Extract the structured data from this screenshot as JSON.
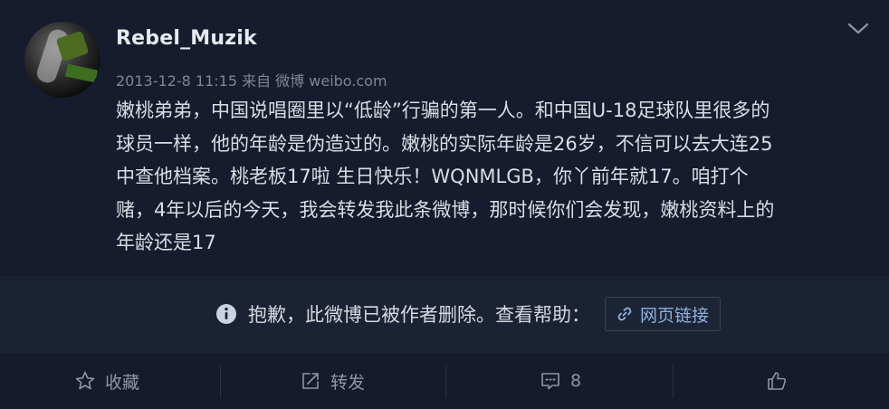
{
  "post": {
    "username": "Rebel_Muzik",
    "meta": "2013-12-8 11:15 来自 微博 weibo.com",
    "lines": [
      "嫩桃弟弟，中国说唱圈里以“低龄”行骗的第一人。和中国U-18足球队里很多的",
      "球员一样，他的年龄是伪造过的。嫩桃的实际年龄是26岁，不信可以去大连25",
      "中查他档案。桃老板17啦 生日快乐！WQNMLGB，你丫前年就17。咱打个",
      "赌，4年以后的今天，我会转发我此条微博，那时候你们会发现，嫩桃资料上的",
      "年龄还是17"
    ]
  },
  "notice": {
    "text": "抱歉，此微博已被作者删除。查看帮助：",
    "link_label": "网页链接"
  },
  "actions": {
    "favorite": "收藏",
    "repost": "转发",
    "comment": "8"
  },
  "icons": [
    "chevron-down-icon",
    "info-icon",
    "link-icon",
    "star-icon",
    "repost-icon",
    "comment-icon",
    "like-icon"
  ],
  "colors": {
    "background": "#151b2c",
    "link": "#8fb1dc",
    "muted": "#8e95a3"
  }
}
